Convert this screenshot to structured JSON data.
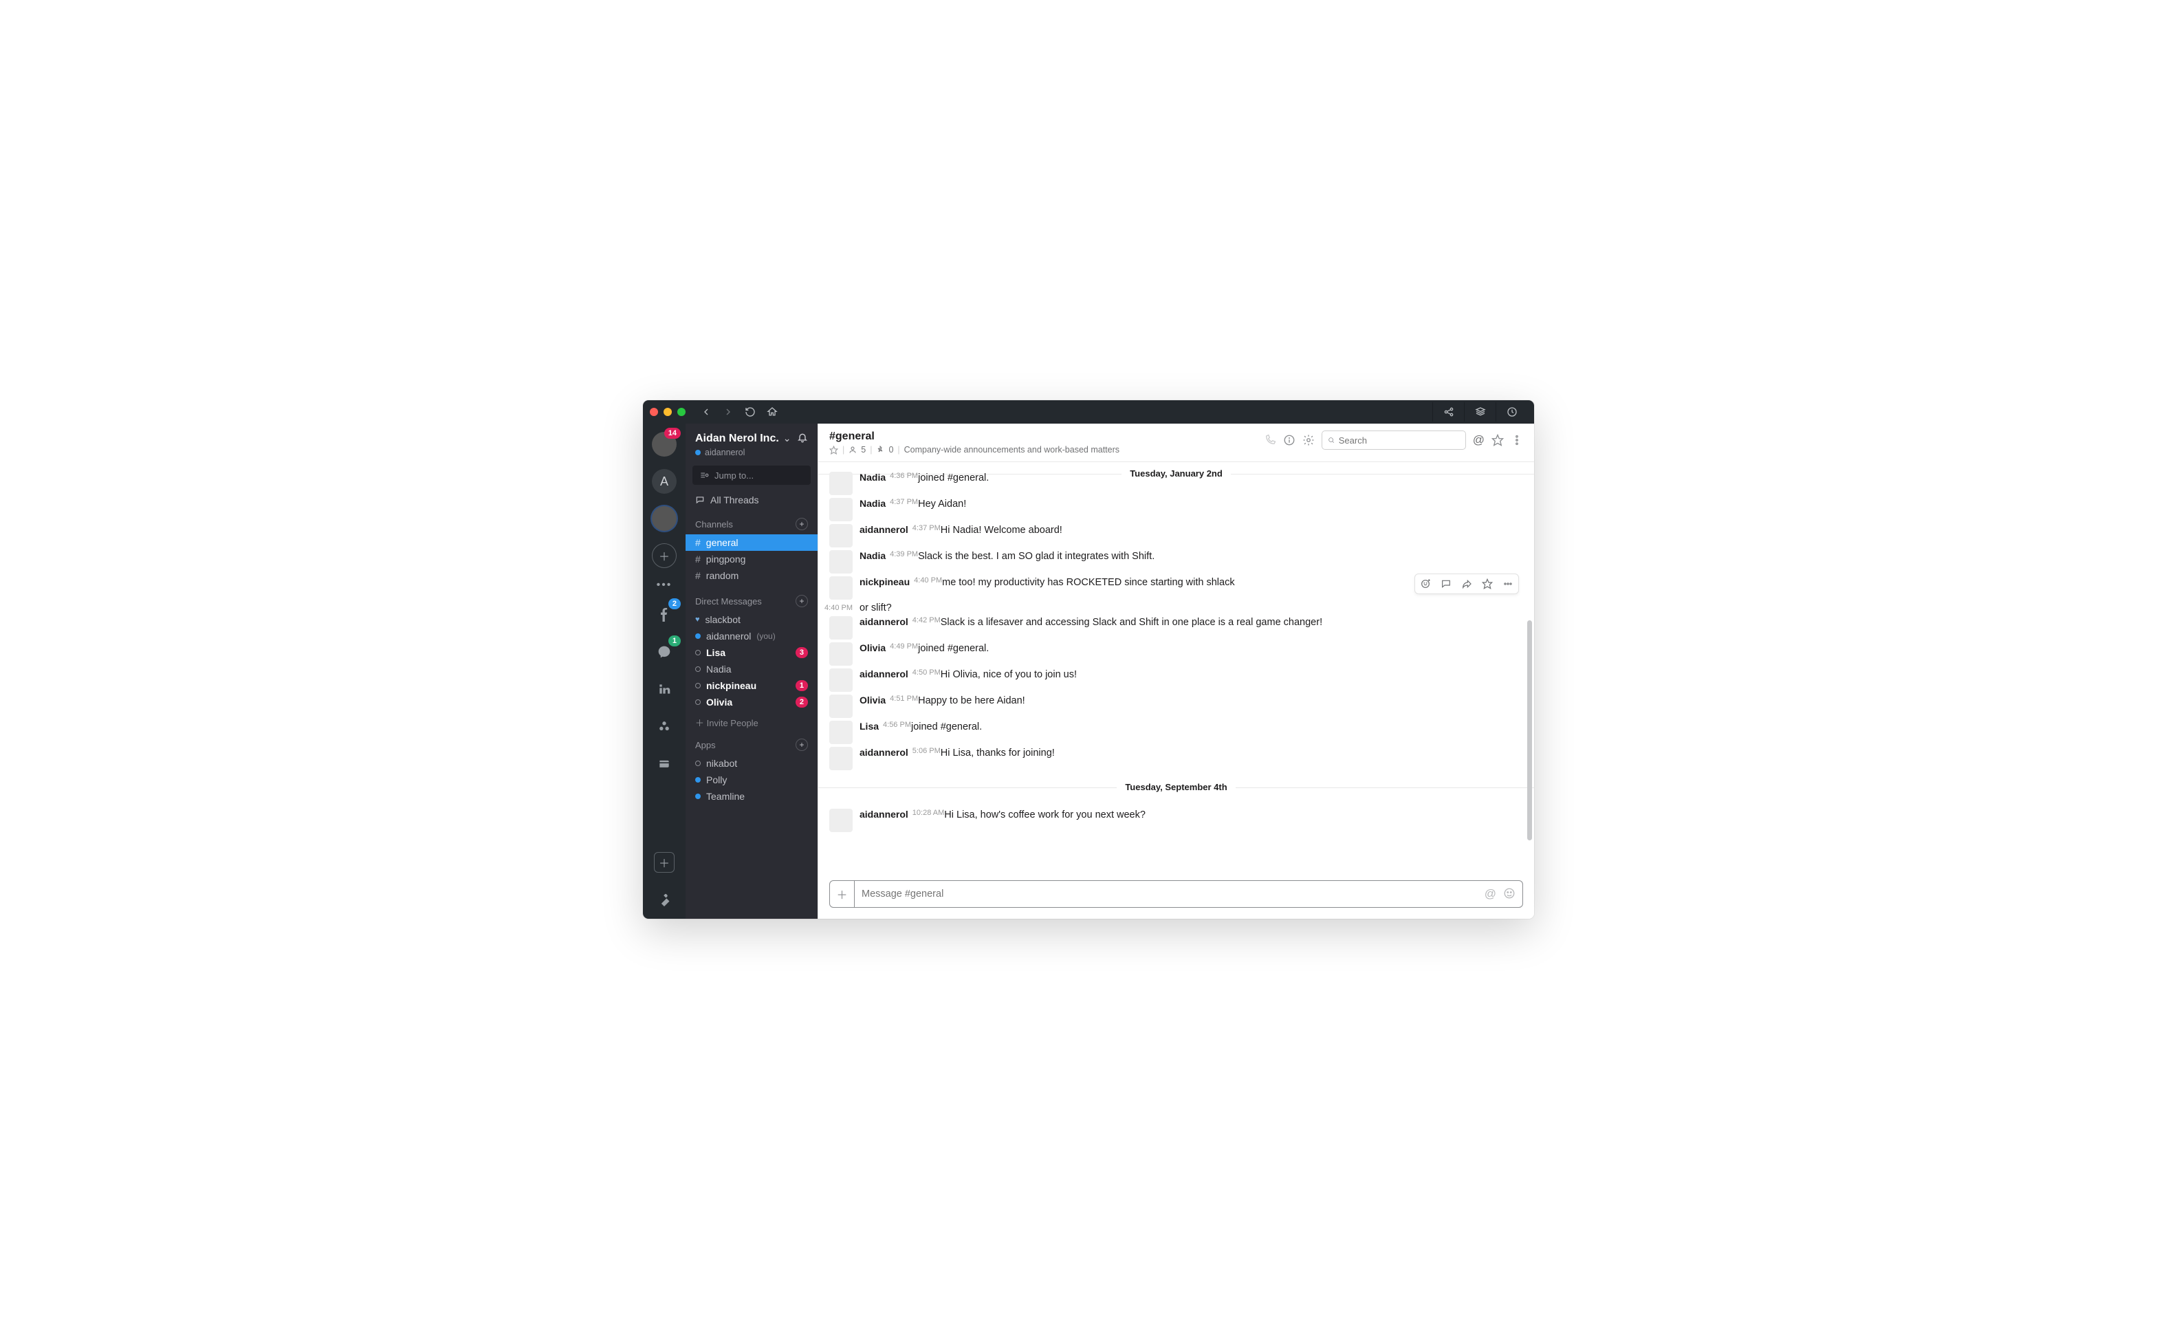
{
  "topbar": {
    "tooltips": {
      "back": "Back",
      "forward": "Forward",
      "reload": "Reload",
      "home": "Home",
      "share": "Share",
      "stack": "Workspaces",
      "clock": "Activity"
    }
  },
  "rail": {
    "accounts": [
      {
        "name": "account-1",
        "badge": "14",
        "badge_color": "red",
        "avatar": "photo"
      },
      {
        "name": "account-2",
        "letter": "A"
      },
      {
        "name": "account-3",
        "avatar": "photo",
        "ring": true
      }
    ],
    "apps": [
      {
        "name": "facebook",
        "badge": "2",
        "badge_color": "blue"
      },
      {
        "name": "messenger",
        "badge": "1",
        "badge_color": "green"
      },
      {
        "name": "linkedin"
      },
      {
        "name": "asana"
      },
      {
        "name": "wallet"
      }
    ]
  },
  "workspace": {
    "name": "Aidan Nerol Inc.",
    "user": "aidannerol"
  },
  "jump_placeholder": "Jump to...",
  "all_threads": "All Threads",
  "sections": {
    "channels": {
      "title": "Channels",
      "items": [
        {
          "name": "general",
          "active": true
        },
        {
          "name": "pingpong"
        },
        {
          "name": "random"
        }
      ]
    },
    "dms": {
      "title": "Direct Messages",
      "items": [
        {
          "name": "slackbot",
          "presence": "heart"
        },
        {
          "name": "aidannerol",
          "presence": "on",
          "you": "(you)"
        },
        {
          "name": "Lisa",
          "presence": "off",
          "bold": true,
          "badge": "3"
        },
        {
          "name": "Nadia",
          "presence": "off"
        },
        {
          "name": "nickpineau",
          "presence": "off",
          "bold": true,
          "badge": "1"
        },
        {
          "name": "Olivia",
          "presence": "off",
          "bold": true,
          "badge": "2"
        }
      ]
    },
    "invite": "Invite People",
    "apps": {
      "title": "Apps",
      "items": [
        {
          "name": "nikabot",
          "presence": "off"
        },
        {
          "name": "Polly",
          "presence": "on"
        },
        {
          "name": "Teamline",
          "presence": "on"
        }
      ]
    }
  },
  "channel_header": {
    "title": "#general",
    "members": "5",
    "pins": "0",
    "topic": "Company-wide announcements and work-based matters",
    "search_placeholder": "Search"
  },
  "dividers": {
    "d1": "Tuesday, January 2nd",
    "d2": "Tuesday, September 4th"
  },
  "messages": [
    {
      "user": "Nadia",
      "time": "4:36 PM",
      "text": "joined #general.",
      "av": "sw-n",
      "cut": true
    },
    {
      "user": "Nadia",
      "time": "4:37 PM",
      "text": "Hey Aidan!",
      "av": "sw-n"
    },
    {
      "user": "aidannerol",
      "time": "4:37 PM",
      "text": "Hi Nadia! Welcome aboard!",
      "av": "sw-a"
    },
    {
      "user": "Nadia",
      "time": "4:39 PM",
      "text": "Slack is the best. I am SO glad it integrates with Shift.",
      "av": "sw-n"
    },
    {
      "user": "nickpineau",
      "time": "4:40 PM",
      "text": "me too! my productivity has ROCKETED since starting with shlack",
      "av": "sw-p",
      "hover": true
    },
    {
      "gutter_time": "4:40 PM",
      "text": "or slift?"
    },
    {
      "user": "aidannerol",
      "time": "4:42 PM",
      "text": "Slack is a lifesaver and accessing Slack and Shift in one place is a real game changer!",
      "av": "sw-a"
    },
    {
      "user": "Olivia",
      "time": "4:49 PM",
      "text": "joined #general.",
      "av": "sw-o"
    },
    {
      "user": "aidannerol",
      "time": "4:50 PM",
      "text": "Hi Olivia, nice of you to join us!",
      "av": "sw-a"
    },
    {
      "user": "Olivia",
      "time": "4:51 PM",
      "text": "Happy to be here Aidan!",
      "av": "sw-o"
    },
    {
      "user": "Lisa",
      "time": "4:56 PM",
      "text": "joined #general.",
      "av": "sw-l"
    },
    {
      "user": "aidannerol",
      "time": "5:06 PM",
      "text": "Hi Lisa, thanks for joining!",
      "av": "sw-a"
    }
  ],
  "messages2": [
    {
      "user": "aidannerol",
      "time": "10:28 AM",
      "text": "Hi Lisa, how's coffee work for you next week?",
      "av": "sw-a"
    }
  ],
  "composer": {
    "placeholder": "Message #general"
  }
}
